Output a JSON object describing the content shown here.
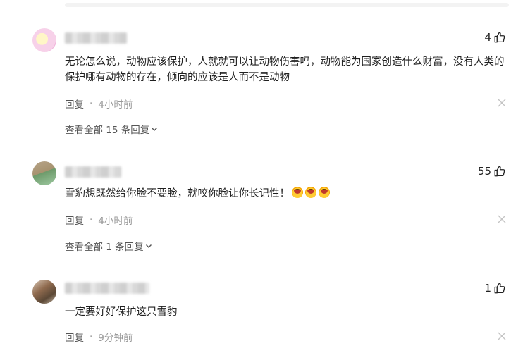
{
  "comments": [
    {
      "likes": "4",
      "text": "无论怎么说，动物应该保护，人就就可以让动物伤害吗，动物能为国家创造什么财富，没有人类的保护哪有动物的存在，倾向的应该是人而不是动物",
      "reply_label": "回复",
      "time": "4小时前",
      "expand_label": "查看全部 15 条回复"
    },
    {
      "likes": "55",
      "text": "雪豹想既然给你脸不要脸，就咬你脸让你长记性！",
      "emoji_count": 3,
      "reply_label": "回复",
      "time": "4小时前",
      "expand_label": "查看全部 1 条回复"
    },
    {
      "likes": "1",
      "text": "一定要好好保护这只雪豹",
      "reply_label": "回复",
      "time": "9分钟前"
    }
  ],
  "separator": "·",
  "colors": {
    "text": "#1f1f1f",
    "meta": "#555555",
    "time": "#999999"
  },
  "icons": [
    "thumb-up-icon",
    "close-icon",
    "chevron-down-icon",
    "laughing-emoji-icon"
  ]
}
